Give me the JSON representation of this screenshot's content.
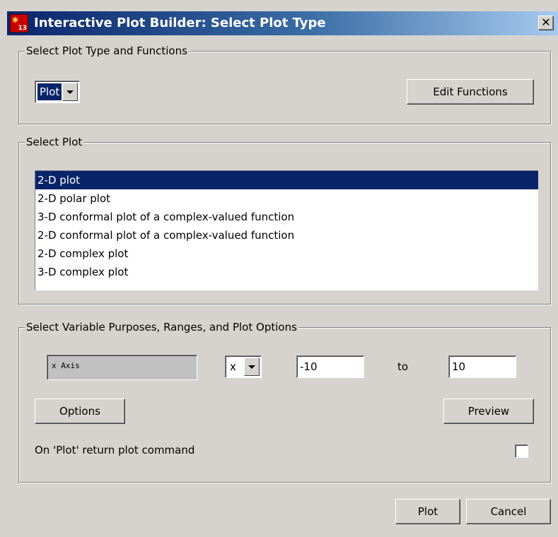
{
  "window": {
    "title": "Interactive Plot Builder: Select Plot Type",
    "icon_number": "13",
    "close_glyph": "✕"
  },
  "plot_type_group": {
    "legend": "Select Plot Type and Functions",
    "plot_type_value": "Plot",
    "edit_functions_label": "Edit Functions"
  },
  "select_plot_group": {
    "legend": "Select Plot",
    "items": [
      "2-D plot",
      "2-D polar plot",
      "3-D conformal plot of a complex-valued function",
      "2-D conformal plot of a complex-valued function",
      "2-D complex plot",
      "3-D complex plot"
    ],
    "selected_index": 0
  },
  "variables_group": {
    "legend": "Select Variable Purposes, Ranges, and Plot Options",
    "variable_field": "x Axis",
    "variable_select": "x",
    "range_from": "-10",
    "range_to_label": "to",
    "range_to": "10",
    "options_label": "Options",
    "preview_label": "Preview",
    "return_command_label": "On 'Plot' return plot command"
  },
  "footer": {
    "plot_label": "Plot",
    "cancel_label": "Cancel"
  }
}
